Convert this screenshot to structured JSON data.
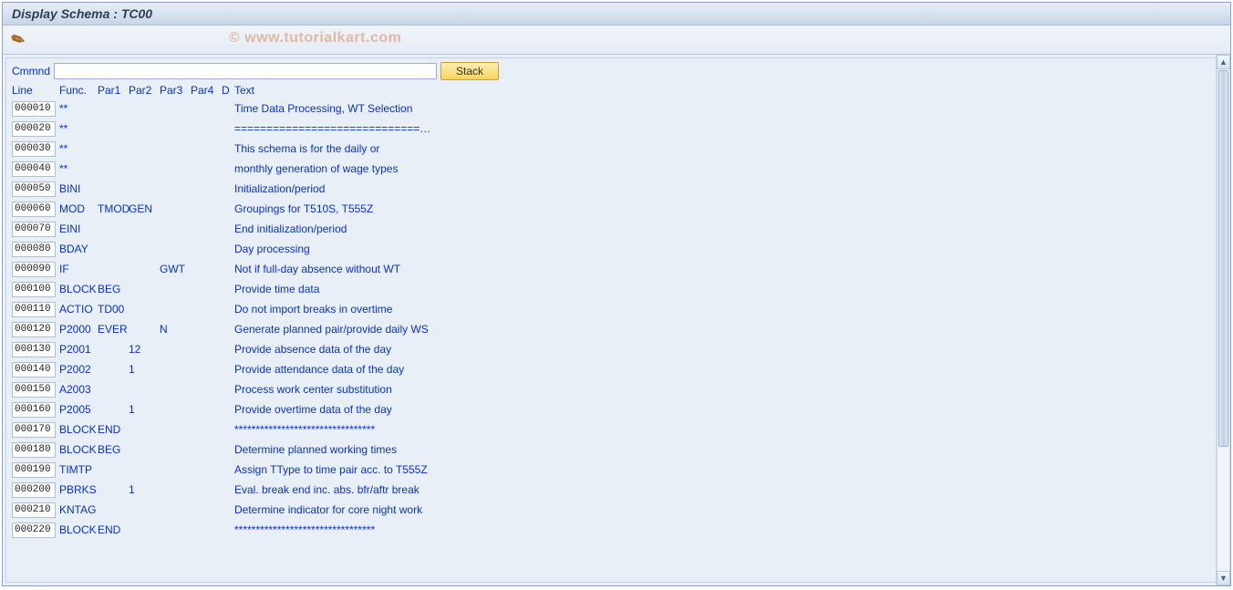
{
  "window": {
    "title": "Display Schema : TC00"
  },
  "watermark": "© www.tutorialkart.com",
  "cmnd": {
    "label": "Cmmnd",
    "value": "",
    "stack_label": "Stack"
  },
  "headers": {
    "line": "Line",
    "func": "Func.",
    "par1": "Par1",
    "par2": "Par2",
    "par3": "Par3",
    "par4": "Par4",
    "d": "D",
    "text": "Text"
  },
  "rows": [
    {
      "line": "000010",
      "func": "**",
      "par1": "",
      "par2": "",
      "par3": "",
      "par4": "",
      "d": "",
      "text": "Time Data Processing, WT Selection"
    },
    {
      "line": "000020",
      "func": "**",
      "par1": "",
      "par2": "",
      "par3": "",
      "par4": "",
      "d": "",
      "text": "=============================…"
    },
    {
      "line": "000030",
      "func": "**",
      "par1": "",
      "par2": "",
      "par3": "",
      "par4": "",
      "d": "",
      "text": "This schema is for the daily or"
    },
    {
      "line": "000040",
      "func": "**",
      "par1": "",
      "par2": "",
      "par3": "",
      "par4": "",
      "d": "",
      "text": "monthly generation of wage types"
    },
    {
      "line": "000050",
      "func": "BINI",
      "par1": "",
      "par2": "",
      "par3": "",
      "par4": "",
      "d": "",
      "text": "Initialization/period"
    },
    {
      "line": "000060",
      "func": "MOD",
      "par1": "TMOD",
      "par2": "GEN",
      "par3": "",
      "par4": "",
      "d": "",
      "text": "Groupings for T510S, T555Z"
    },
    {
      "line": "000070",
      "func": "EINI",
      "par1": "",
      "par2": "",
      "par3": "",
      "par4": "",
      "d": "",
      "text": "End initialization/period"
    },
    {
      "line": "000080",
      "func": "BDAY",
      "par1": "",
      "par2": "",
      "par3": "",
      "par4": "",
      "d": "",
      "text": "Day processing"
    },
    {
      "line": "000090",
      "func": "IF",
      "par1": "",
      "par2": "",
      "par3": "GWT",
      "par4": "",
      "d": "",
      "text": "Not if full-day absence without WT"
    },
    {
      "line": "000100",
      "func": "BLOCK",
      "par1": "BEG",
      "par2": "",
      "par3": "",
      "par4": "",
      "d": "",
      "text": "Provide time data"
    },
    {
      "line": "000110",
      "func": "ACTIO",
      "par1": "TD00",
      "par2": "",
      "par3": "",
      "par4": "",
      "d": "",
      "text": "Do not import breaks in overtime"
    },
    {
      "line": "000120",
      "func": "P2000",
      "par1": "EVER",
      "par2": "",
      "par3": "N",
      "par4": "",
      "d": "",
      "text": "Generate planned pair/provide daily WS"
    },
    {
      "line": "000130",
      "func": "P2001",
      "par1": "",
      "par2": "12",
      "par3": "",
      "par4": "",
      "d": "",
      "text": "Provide absence data of the day"
    },
    {
      "line": "000140",
      "func": "P2002",
      "par1": "",
      "par2": "1",
      "par3": "",
      "par4": "",
      "d": "",
      "text": "Provide attendance data of the day"
    },
    {
      "line": "000150",
      "func": "A2003",
      "par1": "",
      "par2": "",
      "par3": "",
      "par4": "",
      "d": "",
      "text": "Process work center substitution"
    },
    {
      "line": "000160",
      "func": "P2005",
      "par1": "",
      "par2": "1",
      "par3": "",
      "par4": "",
      "d": "",
      "text": "Provide overtime data of the day"
    },
    {
      "line": "000170",
      "func": "BLOCK",
      "par1": "END",
      "par2": "",
      "par3": "",
      "par4": "",
      "d": "",
      "text": "*********************************"
    },
    {
      "line": "000180",
      "func": "BLOCK",
      "par1": "BEG",
      "par2": "",
      "par3": "",
      "par4": "",
      "d": "",
      "text": "Determine planned working times"
    },
    {
      "line": "000190",
      "func": "TIMTP",
      "par1": "",
      "par2": "",
      "par3": "",
      "par4": "",
      "d": "",
      "text": "Assign TType to time pair acc. to T555Z"
    },
    {
      "line": "000200",
      "func": "PBRKS",
      "par1": "",
      "par2": "1",
      "par3": "",
      "par4": "",
      "d": "",
      "text": "Eval. break end inc. abs. bfr/aftr break"
    },
    {
      "line": "000210",
      "func": "KNTAG",
      "par1": "",
      "par2": "",
      "par3": "",
      "par4": "",
      "d": "",
      "text": "Determine indicator for core night work"
    },
    {
      "line": "000220",
      "func": "BLOCK",
      "par1": "END",
      "par2": "",
      "par3": "",
      "par4": "",
      "d": "",
      "text": "*********************************"
    }
  ]
}
